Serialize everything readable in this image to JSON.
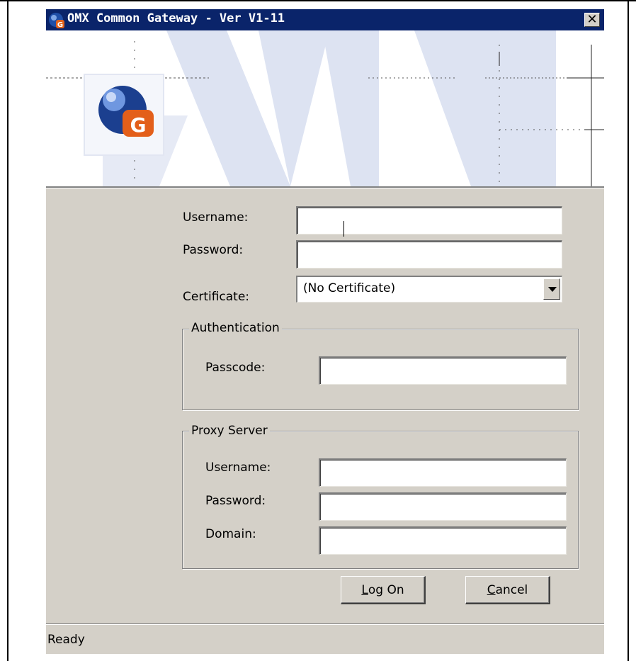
{
  "window": {
    "title": "OMX Common Gateway - Ver V1-11",
    "close_symbol": "✕",
    "icon": "omx-gateway-logo-icon"
  },
  "form": {
    "username_label": "Username:",
    "username_value": "",
    "password_label": "Password:",
    "password_value": "",
    "certificate_label": "Certificate:",
    "certificate_selected": "(No Certificate)"
  },
  "authentication": {
    "legend": "Authentication",
    "passcode_label": "Passcode:",
    "passcode_value": ""
  },
  "proxy": {
    "legend": "Proxy Server",
    "username_label": "Username:",
    "username_value": "",
    "password_label": "Password:",
    "password_value": "",
    "domain_label": "Domain:",
    "domain_value": ""
  },
  "buttons": {
    "logon_underline": "L",
    "logon_rest": "og On",
    "cancel_underline": "C",
    "cancel_rest": "ancel"
  },
  "status": {
    "text": "Ready"
  },
  "colors": {
    "titlebar": "#0a246a",
    "face": "#d4d0c8",
    "banner_shapes": "#dde3f2"
  }
}
